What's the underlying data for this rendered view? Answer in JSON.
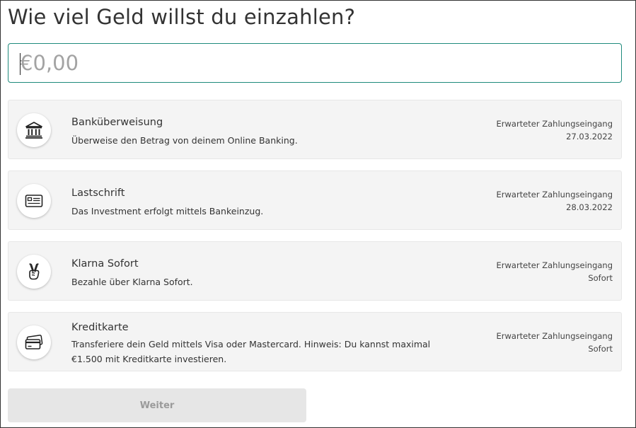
{
  "page": {
    "title": "Wie viel Geld willst du einzahlen?"
  },
  "amount": {
    "value": "",
    "placeholder": "€0,00"
  },
  "methods": [
    {
      "title": "Banküberweisung",
      "description": "Überweise den Betrag von deinem Online Banking.",
      "eta_label": "Erwarteter Zahlungseingang",
      "eta_value": "27.03.2022",
      "icon": "bank-icon"
    },
    {
      "title": "Lastschrift",
      "description": "Das Investment erfolgt mittels Bankeinzug.",
      "eta_label": "Erwarteter Zahlungseingang",
      "eta_value": "28.03.2022",
      "icon": "id-card-icon"
    },
    {
      "title": "Klarna Sofort",
      "description": "Bezahle über Klarna Sofort.",
      "eta_label": "Erwarteter Zahlungseingang",
      "eta_value": "Sofort",
      "icon": "victory-hand-icon"
    },
    {
      "title": "Kreditkarte",
      "description": "Transferiere dein Geld mittels Visa oder Mastercard. Hinweis: Du kannst maximal €1.500 mit Kreditkarte investieren.",
      "eta_label": "Erwarteter Zahlungseingang",
      "eta_value": "Sofort",
      "icon": "credit-cards-icon"
    }
  ],
  "actions": {
    "continue_label": "Weiter"
  },
  "colors": {
    "accent": "#1f8b7c",
    "card_background": "#f4f4f4",
    "button_disabled": "#e6e6e6"
  }
}
